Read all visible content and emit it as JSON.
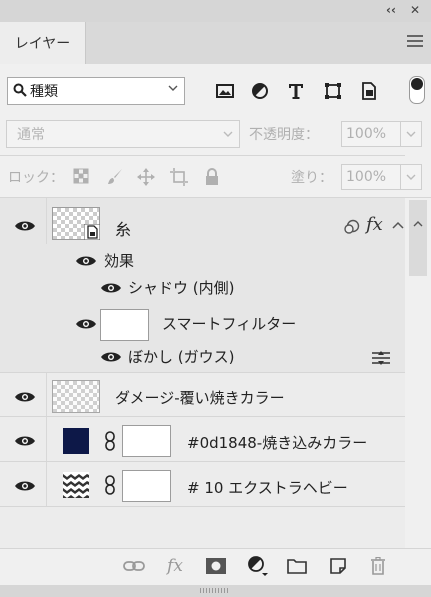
{
  "panel": {
    "collapse_glyph": "‹‹",
    "close_glyph": "✕",
    "tab_label": "レイヤー",
    "menu_icon": "hamburger-menu-icon"
  },
  "filter": {
    "kind_label": "種類",
    "search_icon": "search-icon",
    "icons": [
      "image-filter-icon",
      "adjustment-filter-icon",
      "type-filter-icon",
      "shape-filter-icon",
      "smart-object-filter-icon"
    ],
    "toggle_on": true
  },
  "blend": {
    "mode": "通常",
    "opacity_label": "不透明度：",
    "opacity_value": "100%",
    "lock_label": "ロック：",
    "fill_label": "塗り：",
    "fill_value": "100%"
  },
  "layers": [
    {
      "name": "糸",
      "type": "smart-object",
      "selected": true,
      "has_fx": true,
      "fx_label": "fx",
      "effects_label": "効果",
      "effects": [
        "シャドウ (内側)"
      ],
      "smart_filter_label": "スマートフィルター",
      "smart_filters": [
        "ぼかし (ガウス)"
      ]
    },
    {
      "name": "ダメージ-覆い焼きカラー",
      "type": "pixel"
    },
    {
      "name": "#0d1848-焼き込みカラー",
      "type": "fill",
      "swatch_color": "#0d1848"
    },
    {
      "name": "# 10 エクストラヘビー",
      "type": "pattern-fill"
    }
  ],
  "bottom_bar": {
    "icons": [
      "link-layers-icon",
      "fx-icon",
      "add-mask-icon",
      "new-adjustment-icon",
      "new-group-icon",
      "new-layer-icon",
      "delete-icon"
    ],
    "fx_label": "fx"
  },
  "colors": {
    "panel_bg": "#f0f0f0",
    "selected_row": "#e6e6e6",
    "swatch": "#0d1848"
  }
}
